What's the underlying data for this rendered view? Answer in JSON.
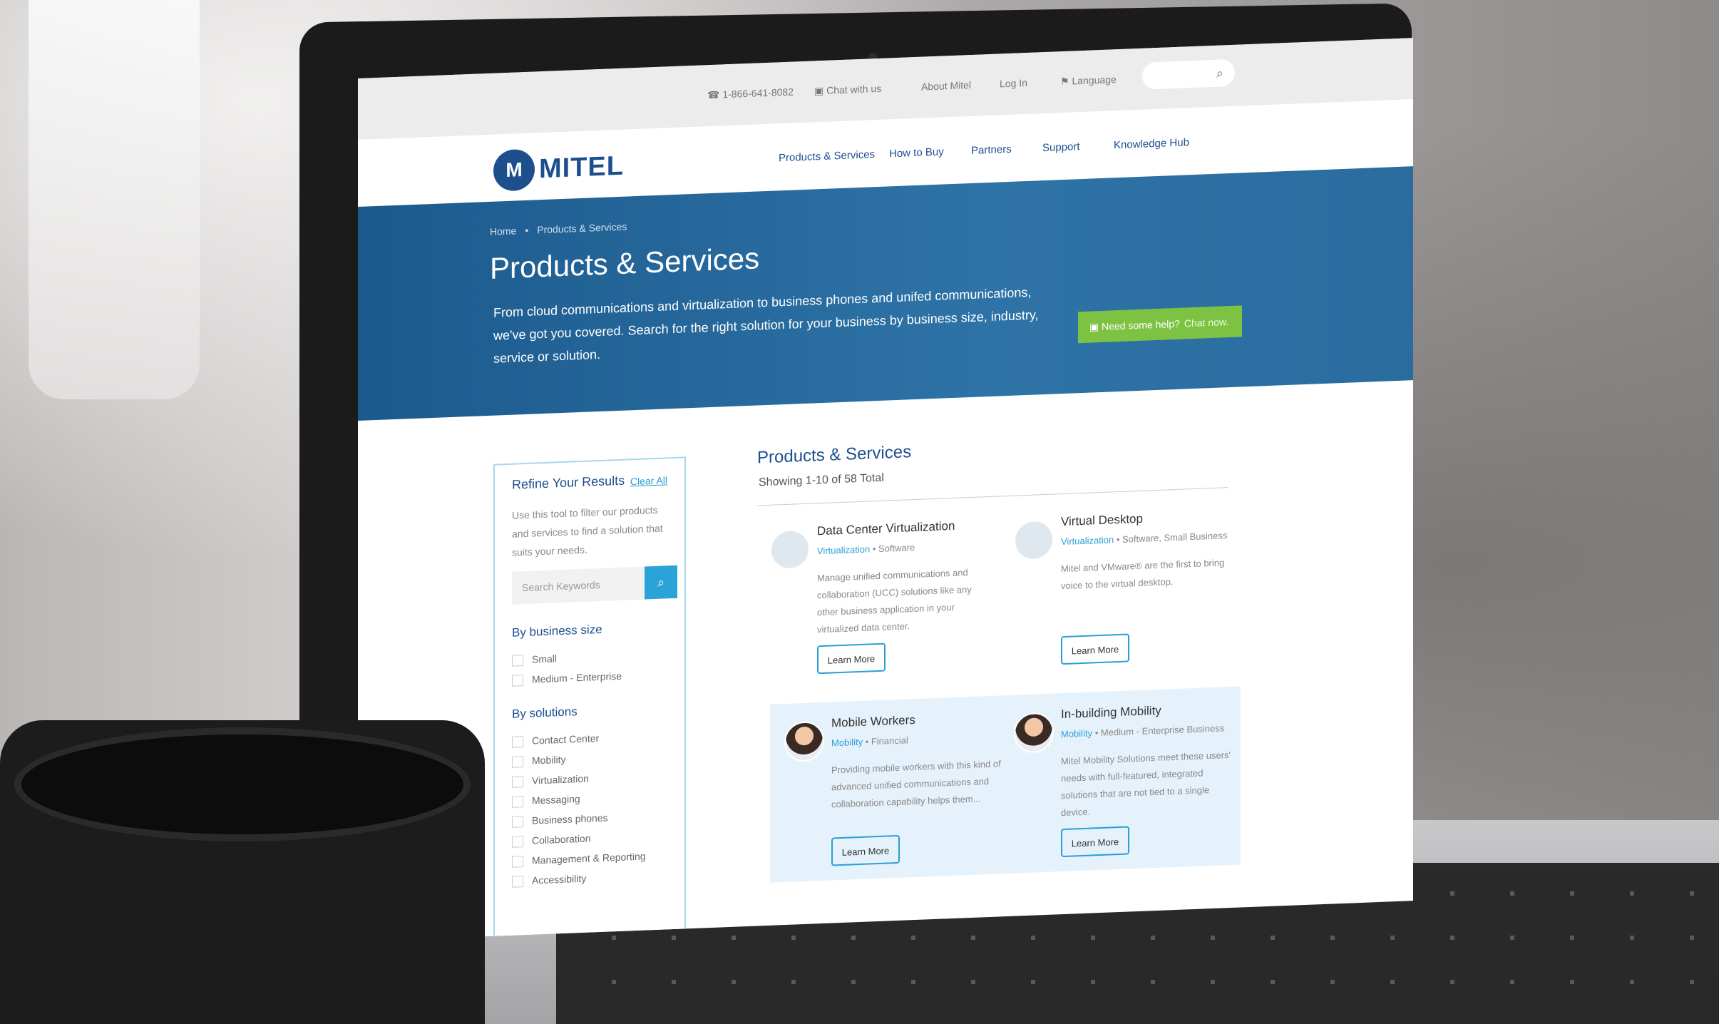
{
  "topbar": {
    "phone": "1-866-641-8082",
    "chat": "Chat with us",
    "about": "About Mitel",
    "login": "Log In",
    "language": "Language"
  },
  "logo": {
    "text": "MITEL"
  },
  "nav": [
    "Products & Services",
    "How to Buy",
    "Partners",
    "Support",
    "Knowledge Hub"
  ],
  "hero": {
    "breadcrumb_home": "Home",
    "breadcrumb_current": "Products & Services",
    "title": "Products & Services",
    "text": "From cloud communications and virtualization to business phones and unifed communications, we've got you covered. Search for the right solution for your business by business size, industry, service or solution.",
    "help": "Need some help?",
    "help_link": "Chat now."
  },
  "filter": {
    "title": "Refine Your Results",
    "clear": "Clear All",
    "hint": "Use this tool to filter our products and services to find a solution that suits your needs.",
    "search_placeholder": "Search Keywords",
    "group_size": "By business size",
    "size_options": [
      "Small",
      "Medium - Enterprise"
    ],
    "group_solutions": "By solutions",
    "solution_options": [
      "Contact Center",
      "Mobility",
      "Virtualization",
      "Messaging",
      "Business phones",
      "Collaboration",
      "Management & Reporting",
      "Accessibility"
    ]
  },
  "results": {
    "title": "Products & Services",
    "count": "Showing 1-10 of 58 Total",
    "cards": [
      {
        "title": "Data Center Virtualization",
        "category": "Virtualization",
        "tags": " • Software",
        "desc": "Manage unified communications and collaboration (UCC) solutions like any other business application in your virtualized data center.",
        "button": "Learn More"
      },
      {
        "title": "Virtual Desktop",
        "category": "Virtualization",
        "tags": " • Software, Small Business",
        "desc": "Mitel and VMware® are the first to bring voice to the virtual desktop.",
        "button": "Learn More"
      },
      {
        "title": "Mobile Workers",
        "category": "Mobility",
        "tags": " • Financial",
        "desc": "Providing mobile workers with this kind of advanced unified communications and collaboration capability helps them...",
        "button": "Learn More"
      },
      {
        "title": "In-building Mobility",
        "category": "Mobility",
        "tags": " • Medium - Enterprise Business",
        "desc": "Mitel Mobility Solutions meet these users' needs with full-featured, integrated solutions that are not tied to a single device.",
        "button": "Learn More"
      }
    ]
  }
}
